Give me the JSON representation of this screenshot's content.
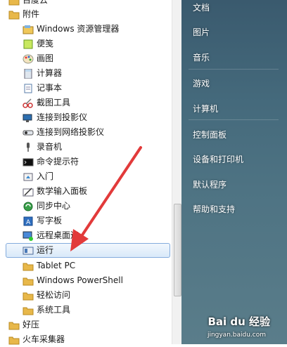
{
  "menu": {
    "top_cut": "百度云",
    "accessories": "附件",
    "items": [
      "Windows 资源管理器",
      "便笺",
      "画图",
      "计算器",
      "记事本",
      "截图工具",
      "连接到投影仪",
      "连接到网络投影仪",
      "录音机",
      "命令提示符",
      "入门",
      "数学输入面板",
      "同步中心",
      "写字板",
      "远程桌面连",
      "运行"
    ],
    "subfolders": [
      "Tablet PC",
      "Windows PowerShell",
      "轻松访问",
      "系统工具"
    ],
    "bottom": [
      "好压",
      "火车采集器"
    ]
  },
  "right_panel": {
    "items": [
      "文档",
      "图片",
      "音乐",
      "游戏",
      "计算机",
      "控制面板",
      "设备和打印机",
      "默认程序",
      "帮助和支持"
    ]
  },
  "watermark": {
    "text": "Bai du 经验",
    "url": "jingyan.baidu.com"
  },
  "colors": {
    "selection": "#d9e9f9",
    "arrow": "#e23a3a",
    "folder": "#e8b84a"
  }
}
